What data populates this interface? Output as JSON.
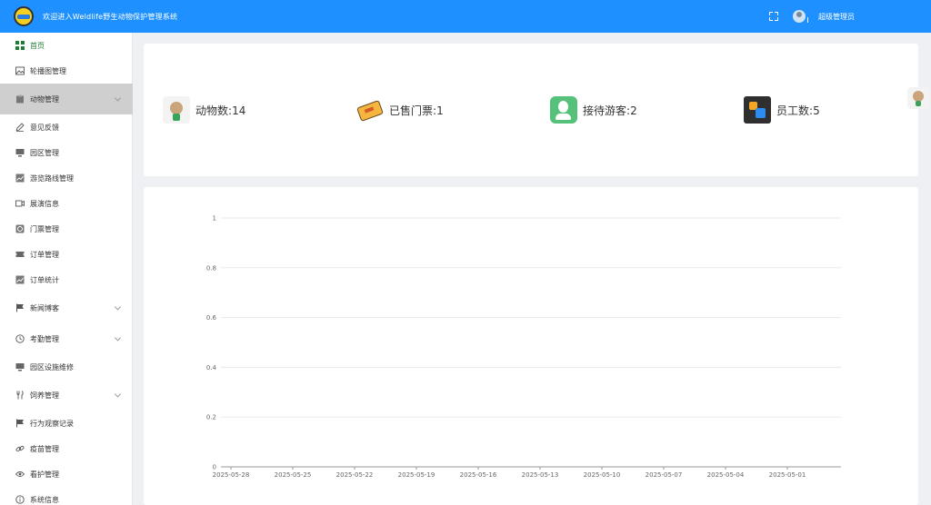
{
  "header": {
    "app_title": "欢迎进入Weldlife野生动物保护管理系统",
    "username": "超级管理员",
    "colors": {
      "bar": "#1e90ff"
    }
  },
  "sidebar": {
    "items": [
      {
        "label": "首页",
        "icon": "dashboard-icon",
        "active": true
      },
      {
        "label": "轮播图管理",
        "icon": "image-icon"
      },
      {
        "label": "动物管理",
        "icon": "clipboard-icon",
        "expandable": true,
        "expanded": true
      },
      {
        "label": "意见反馈",
        "icon": "pencil-icon"
      },
      {
        "label": "园区管理",
        "icon": "monitor-icon"
      },
      {
        "label": "游览路线管理",
        "icon": "line-chart-icon"
      },
      {
        "label": "展演信息",
        "icon": "video-icon"
      },
      {
        "label": "门票管理",
        "icon": "copyright-icon"
      },
      {
        "label": "订单管理",
        "icon": "ticket-icon"
      },
      {
        "label": "订单统计",
        "icon": "line-chart-icon"
      },
      {
        "label": "新闻博客",
        "icon": "flag-icon",
        "expandable": true
      },
      {
        "label": "考勤管理",
        "icon": "clock-icon",
        "expandable": true
      },
      {
        "label": "园区设施维修",
        "icon": "monitor-icon"
      },
      {
        "label": "饲养管理",
        "icon": "fork-knife-icon",
        "expandable": true
      },
      {
        "label": "行为观察记录",
        "icon": "flag-icon"
      },
      {
        "label": "疫苗管理",
        "icon": "link-icon"
      },
      {
        "label": "看护管理",
        "icon": "eye-icon"
      },
      {
        "label": "系统信息",
        "icon": "info-icon"
      }
    ]
  },
  "stats": [
    {
      "label": "动物数",
      "value": "14",
      "icon": "animal-icon"
    },
    {
      "label": "已售门票",
      "value": "1",
      "icon": "ticket-stack-icon"
    },
    {
      "label": "接待游客",
      "value": "2",
      "icon": "visitor-icon"
    },
    {
      "label": "员工数",
      "value": "5",
      "icon": "staff-icon"
    }
  ],
  "chart_data": {
    "type": "line",
    "categories": [
      "2025-05-28",
      "2025-05-25",
      "2025-05-22",
      "2025-05-19",
      "2025-05-16",
      "2025-05-13",
      "2025-05-10",
      "2025-05-07",
      "2025-05-04",
      "2025-05-01"
    ],
    "y_ticks": [
      "0",
      "0.2",
      "0.4",
      "0.6",
      "0.8",
      "1"
    ],
    "ylim": [
      0,
      1
    ],
    "grid": true,
    "series": []
  }
}
